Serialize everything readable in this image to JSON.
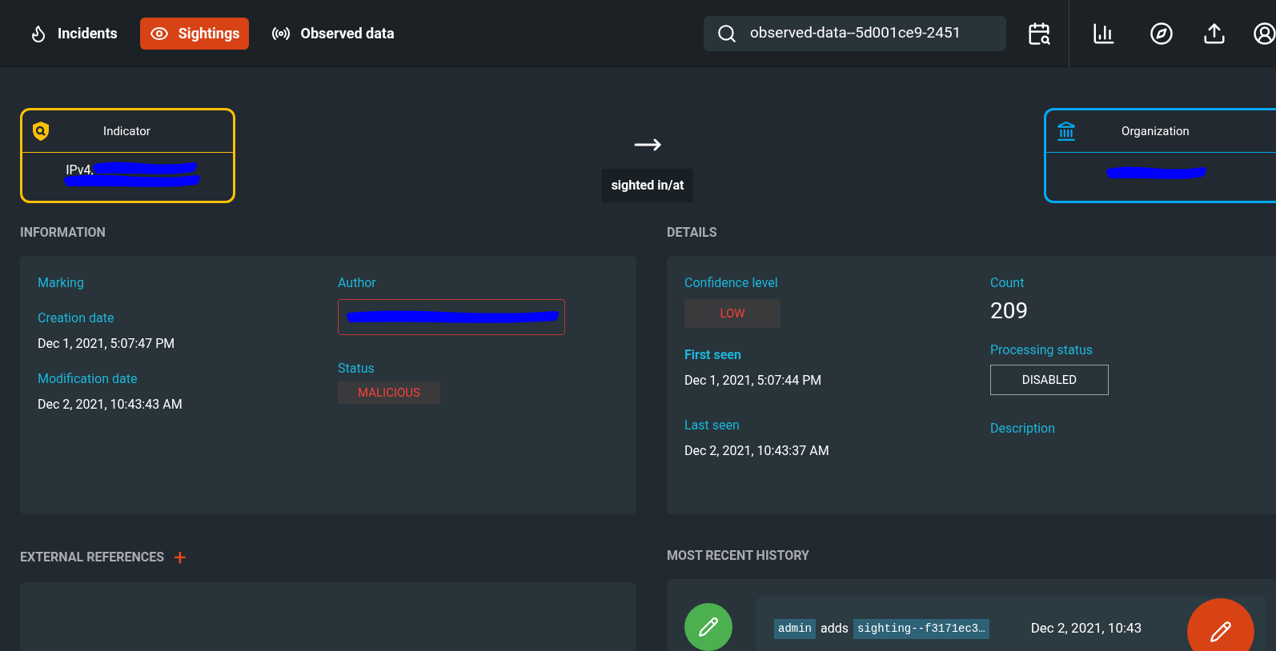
{
  "nav": {
    "items": [
      {
        "label": "Incidents",
        "selected": false
      },
      {
        "label": "Sightings",
        "selected": true
      },
      {
        "label": "Observed data",
        "selected": false
      }
    ],
    "search": {
      "value": "observed-data--5d001ce9-2451"
    }
  },
  "relation": {
    "from": {
      "type": "Indicator",
      "name": "IPv4,"
    },
    "label": "sighted in/at",
    "to": {
      "type": "Organization"
    }
  },
  "information": {
    "title": "INFORMATION",
    "marking_label": "Marking",
    "creation_label": "Creation date",
    "creation": "Dec 1, 2021, 5:07:47 PM",
    "modification_label": "Modification date",
    "modification": "Dec 2, 2021, 10:43:43 AM",
    "author_label": "Author",
    "status_label": "Status",
    "status": "MALICIOUS"
  },
  "details": {
    "title": "DETAILS",
    "confidence_label": "Confidence level",
    "confidence": "LOW",
    "first_seen_label": "First seen",
    "first_seen": "Dec 1, 2021, 5:07:44 PM",
    "last_seen_label": "Last seen",
    "last_seen": "Dec 2, 2021, 10:43:37 AM",
    "count_label": "Count",
    "count": "209",
    "processing_label": "Processing status",
    "processing": "DISABLED",
    "description_label": "Description"
  },
  "external_references": {
    "title": "EXTERNAL REFERENCES",
    "add": "+"
  },
  "history": {
    "title": "MOST RECENT HISTORY",
    "entries": [
      {
        "user": "admin",
        "action": "adds",
        "object": "sighting--f3171ec3…",
        "date": "Dec 2, 2021, 10:43"
      }
    ]
  }
}
